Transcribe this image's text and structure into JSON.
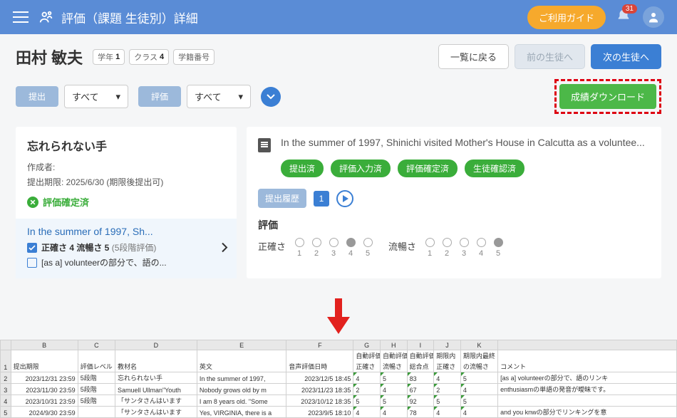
{
  "header": {
    "title": "評価（課題 生徒別）詳細",
    "guide": "ご利用ガイド",
    "badge": "31"
  },
  "student": {
    "name": "田村 敏夫",
    "gradeLabel": "学年",
    "grade": "1",
    "classLabel": "クラス",
    "class": "4",
    "idLabel": "学籍番号"
  },
  "nav": {
    "back": "一覧に戻る",
    "prev": "前の生徒へ",
    "next": "次の生徒へ"
  },
  "filter": {
    "submitLabel": "提出",
    "submitAll": "すべて",
    "evalLabel": "評価",
    "evalAll": "すべて",
    "download": "成績ダウンロード"
  },
  "assignment": {
    "title": "忘れられない手",
    "author": "作成者:",
    "deadline": "提出期限: 2025/6/30 (期限後提出可)",
    "confirmed": "評価確定済",
    "taskTitle": "In the summer of 1997, Sh...",
    "score": "正確さ 4  流暢さ 5",
    "scoreNote": "(5段階評価)",
    "comment": "[as a] volunteerの部分で、語の..."
  },
  "detail": {
    "text": "In the summer of 1997, Shinichi visited Mother's House in Calcutta as a voluntee...",
    "pills": [
      "提出済",
      "評価入力済",
      "評価確定済",
      "生徒確認済"
    ],
    "historyLabel": "提出履歴",
    "pageNum": "1",
    "evalHeading": "評価",
    "accuracy": "正確さ",
    "fluency": "流暢さ",
    "accuracyVal": 4,
    "fluencyVal": 5
  },
  "excel": {
    "cols": [
      "",
      "B",
      "C",
      "D",
      "E",
      "F",
      "G",
      "H",
      "I",
      "J",
      "K",
      ""
    ],
    "header1": [
      "",
      "",
      "",
      "",
      "",
      "",
      "自動評価",
      "自動評価",
      "自動評価",
      "期限内\n最終の",
      "期限内最終",
      ""
    ],
    "header2": [
      "1",
      "提出期限",
      "評価レベル",
      "教材名",
      "英文",
      "音声評価日時",
      "正確さ",
      "流暢さ",
      "総合点",
      "正確さ",
      "の流暢さ",
      "コメント"
    ],
    "rows": [
      [
        "2",
        "2023/12/31 23:59",
        "5段階",
        "忘れられない手",
        "In the summer of 1997,",
        "2023/12/5 18:45",
        "4",
        "5",
        "83",
        "4",
        "5",
        "[as a] volunteerの部分で、語のリンキ"
      ],
      [
        "3",
        "2023/11/30 23:59",
        "5段階",
        "Samuell Ullman\"Youth",
        "Nobody grows old by m",
        "2023/11/23 18:35",
        "2",
        "4",
        "67",
        "2",
        "4",
        "enthusiasmの単語の発音が曖昧です。"
      ],
      [
        "4",
        "2023/10/31 23:59",
        "5段階",
        "「サンタさんはいます",
        "I am 8 years old. \"Some",
        "2023/10/12 18:35",
        "5",
        "5",
        "92",
        "5",
        "5",
        ""
      ],
      [
        "5",
        "2024/9/30 23:59",
        "",
        "「サンタさんはいます",
        "Yes, VIRGINIA, there is a",
        "2023/9/5 18:10",
        "4",
        "4",
        "78",
        "4",
        "4",
        "and you knwの部分でリンキングを意"
      ]
    ]
  }
}
